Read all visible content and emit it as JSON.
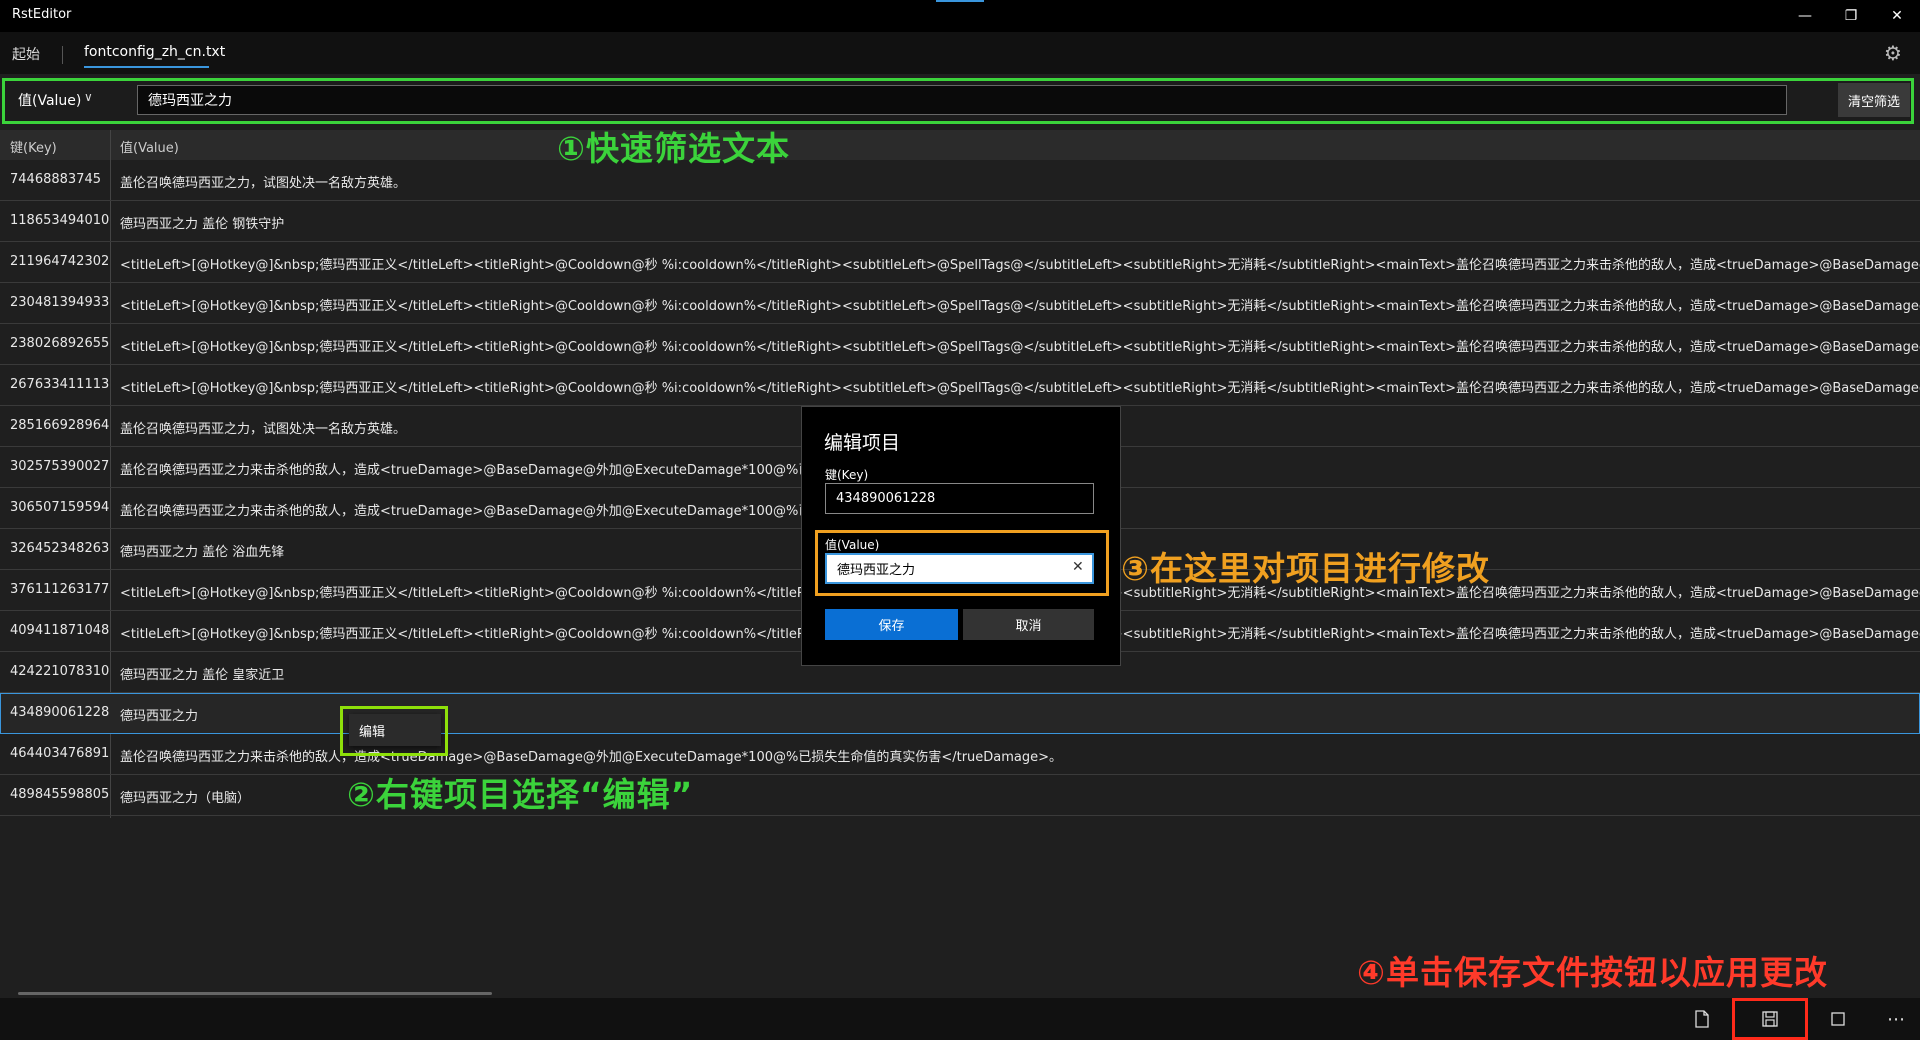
{
  "window": {
    "title": "RstEditor",
    "minimize": "—",
    "restore": "❐",
    "close": "✕"
  },
  "tabs": [
    {
      "label": "起始"
    },
    {
      "label": "fontconfig_zh_cn.txt"
    }
  ],
  "settings_icon": "gear-icon",
  "filter": {
    "field": "值(Value)",
    "chevron": "∨",
    "value": "德玛西亚之力",
    "clear_label": "清空筛选"
  },
  "annotations": {
    "step1": "①快速筛选文本",
    "step2": "②右键项目选择“编辑”",
    "step3": "③在这里对项目进行修改",
    "step4": "④单击保存文件按钮以应用更改"
  },
  "grid": {
    "columns": [
      "键(Key)",
      "值(Value)"
    ],
    "rows": [
      {
        "key": "74468883745",
        "value": "盖伦召唤德玛西亚之力，试图处决一名敌方英雄。"
      },
      {
        "key": "118653494010",
        "value": "德玛西亚之力 盖伦 钢铁守护"
      },
      {
        "key": "211964742302",
        "value": "<titleLeft>[@Hotkey@]&nbsp;德玛西亚正义</titleLeft><titleRight>@Cooldown@秒 %i:cooldown%</titleRight><subtitleLeft>@SpellTags@</subtitleLeft><subtitleRight>无消耗</subtitleRight><mainText>盖伦召唤德玛西亚之力来击杀他的敌人，造成<trueDamage>@BaseDamage@外加@"
      },
      {
        "key": "230481394933",
        "value": "<titleLeft>[@Hotkey@]&nbsp;德玛西亚正义</titleLeft><titleRight>@Cooldown@秒 %i:cooldown%</titleRight><subtitleLeft>@SpellTags@</subtitleLeft><subtitleRight>无消耗</subtitleRight><mainText>盖伦召唤德玛西亚之力来击杀他的敌人，造成<trueDamage>@BaseDamage@外加@"
      },
      {
        "key": "238026892655",
        "value": "<titleLeft>[@Hotkey@]&nbsp;德玛西亚正义</titleLeft><titleRight>@Cooldown@秒 %i:cooldown%</titleRight><subtitleLeft>@SpellTags@</subtitleLeft><subtitleRight>无消耗</subtitleRight><mainText>盖伦召唤德玛西亚之力来击杀他的敌人，造成<trueDamage>@BaseDamage@外加@"
      },
      {
        "key": "267633411113",
        "value": "<titleLeft>[@Hotkey@]&nbsp;德玛西亚正义</titleLeft><titleRight>@Cooldown@秒 %i:cooldown%</titleRight><subtitleLeft>@SpellTags@</subtitleLeft><subtitleRight>无消耗</subtitleRight><mainText>盖伦召唤德玛西亚之力来击杀他的敌人，造成<trueDamage>@BaseDamage@外加@"
      },
      {
        "key": "285166928964",
        "value": "盖伦召唤德玛西亚之力，试图处决一名敌方英雄。"
      },
      {
        "key": "302575390027",
        "value": "盖伦召唤德玛西亚之力来击杀他的敌人，造成<trueDamage>@BaseDamage@外加@ExecuteDamage*100@%已"
      },
      {
        "key": "306507159594",
        "value": "盖伦召唤德玛西亚之力来击杀他的敌人，造成<trueDamage>@BaseDamage@外加@ExecuteDamage*100@%已"
      },
      {
        "key": "326452348263",
        "value": "德玛西亚之力 盖伦 浴血先锋"
      },
      {
        "key": "376111263177",
        "value": "<titleLeft>[@Hotkey@]&nbsp;德玛西亚正义</titleLeft><titleRight>@Cooldown@秒 %i:cooldown%</titleRight><subtitleLeft>@SpellTags@</subtitleLeft><subtitleRight>无消耗</subtitleRight><mainText>盖伦召唤德玛西亚之力来击杀他的敌人，造成<trueDamage>@BaseDamage@外加@"
      },
      {
        "key": "409411871048",
        "value": "<titleLeft>[@Hotkey@]&nbsp;德玛西亚正义</titleLeft><titleRight>@Cooldown@秒 %i:cooldown%</titleRight><subtitleLeft>@SpellTags@</subtitleLeft><subtitleRight>无消耗</subtitleRight><mainText>盖伦召唤德玛西亚之力来击杀他的敌人，造成<trueDamage>@BaseDamage@外加@"
      },
      {
        "key": "424221078310",
        "value": "德玛西亚之力 盖伦 皇家近卫"
      },
      {
        "key": "434890061228",
        "value": "德玛西亚之力"
      },
      {
        "key": "464403476891",
        "value": "盖伦召唤德玛西亚之力来击杀他的敌人，造成<trueDamage>@BaseDamage@外加@ExecuteDamage*100@%已损失生命值的真实伤害</trueDamage>。"
      },
      {
        "key": "489845598805",
        "value": "德玛西亚之力（电脑）"
      }
    ],
    "selected_index": 13
  },
  "context_menu": {
    "edit_label": "编辑"
  },
  "dialog": {
    "title": "编辑项目",
    "key_label": "键(Key)",
    "key_value": "434890061228",
    "value_label": "值(Value)",
    "value_value": "德玛西亚之力",
    "clear_glyph": "✕",
    "save_label": "保存",
    "cancel_label": "取消"
  },
  "colors": {
    "accent": "#3a96dd",
    "highlight_green": "#3bd33b",
    "highlight_orange": "#f0a020",
    "highlight_red": "#ff2a1a"
  }
}
